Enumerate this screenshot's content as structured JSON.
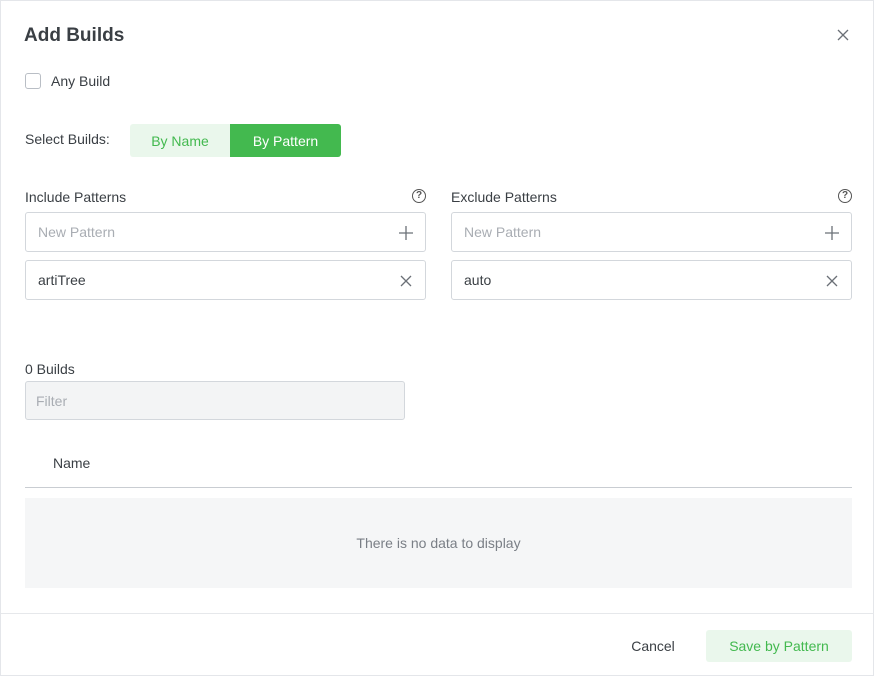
{
  "dialog": {
    "title": "Add Builds"
  },
  "any_build": {
    "label": "Any Build",
    "checked": false
  },
  "select_builds": {
    "label": "Select Builds:",
    "options": [
      "By Name",
      "By Pattern"
    ],
    "selected": "By Pattern"
  },
  "include": {
    "label": "Include Patterns",
    "placeholder": "New Pattern",
    "patterns": [
      "artiTree"
    ]
  },
  "exclude": {
    "label": "Exclude Patterns",
    "placeholder": "New Pattern",
    "patterns": [
      "auto"
    ]
  },
  "builds": {
    "count_label": "0 Builds",
    "filter_placeholder": "Filter",
    "column_name": "Name",
    "empty_text": "There is no data to display"
  },
  "footer": {
    "cancel": "Cancel",
    "save": "Save by Pattern"
  },
  "colors": {
    "accent": "#43b94f",
    "accent_light": "#eaf7ec"
  }
}
